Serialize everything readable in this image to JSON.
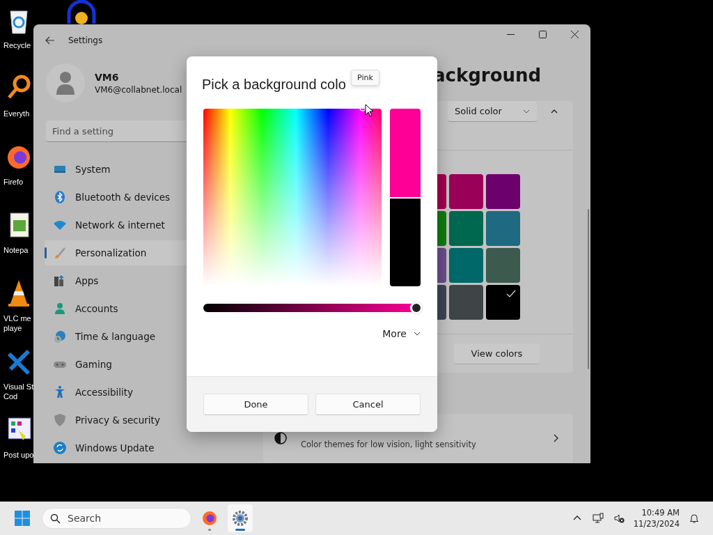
{
  "desktop_icons": [
    {
      "kind": "recycle",
      "label_lines": [
        "Recycle"
      ]
    },
    {
      "kind": "search-tool",
      "label_lines": [
        "Everyth"
      ]
    },
    {
      "kind": "browser",
      "label_lines": [
        "Firefo"
      ]
    },
    {
      "kind": "notepad",
      "label_lines": [
        "Notepa"
      ]
    },
    {
      "kind": "cone",
      "label_lines": [
        "VLC me",
        "playe"
      ]
    },
    {
      "kind": "code",
      "label_lines": [
        "Visual St",
        "Cod"
      ]
    },
    {
      "kind": "grid-app",
      "label_lines": [
        "Post upo"
      ]
    }
  ],
  "settings_window": {
    "title": "Settings",
    "user": {
      "name": "VM6",
      "email": "VM6@collabnet.local"
    },
    "search": {
      "placeholder": "Find a setting"
    },
    "nav": [
      {
        "label": "System",
        "kind": "system",
        "selected": false
      },
      {
        "label": "Bluetooth & devices",
        "kind": "bluetooth",
        "selected": false
      },
      {
        "label": "Network & internet",
        "kind": "network",
        "selected": false
      },
      {
        "label": "Personalization",
        "kind": "brush",
        "selected": true
      },
      {
        "label": "Apps",
        "kind": "apps",
        "selected": false
      },
      {
        "label": "Accounts",
        "kind": "accounts",
        "selected": false
      },
      {
        "label": "Time & language",
        "kind": "time",
        "selected": false
      },
      {
        "label": "Gaming",
        "kind": "gaming",
        "selected": false
      },
      {
        "label": "Accessibility",
        "kind": "accessibility",
        "selected": false
      },
      {
        "label": "Privacy & security",
        "kind": "shield",
        "selected": false
      },
      {
        "label": "Windows Update",
        "kind": "update",
        "selected": false
      }
    ],
    "page_title": "ackground",
    "background_type": "Solid color",
    "swatches": [
      {
        "color": "#a3004d",
        "selected": false
      },
      {
        "color": "#9b0058",
        "selected": false
      },
      {
        "color": "#6c006c",
        "selected": false
      },
      {
        "color": "#107c10",
        "selected": false
      },
      {
        "color": "#00684f",
        "selected": false
      },
      {
        "color": "#1f6981",
        "selected": false
      },
      {
        "color": "#6b4d8c",
        "selected": false
      },
      {
        "color": "#006869",
        "selected": false
      },
      {
        "color": "#3d5a4f",
        "selected": false
      },
      {
        "color": "#3e4453",
        "selected": false
      },
      {
        "color": "#3f4446",
        "selected": false
      },
      {
        "color": "#000000",
        "selected": true
      }
    ],
    "view_colors": "View colors",
    "contrast_description": "Color themes for low vision, light sensitivity"
  },
  "dialog": {
    "title": "Pick a background colo",
    "tooltip": "Pink",
    "previews": [
      {
        "color": "#ff0096"
      },
      {
        "color": "#000000"
      }
    ],
    "brightness": {
      "level": 0.98
    },
    "more": "More",
    "buttons": [
      "Done",
      "Cancel"
    ]
  },
  "taskbar": {
    "search_placeholder": "Search",
    "apps": [
      {
        "kind": "browser",
        "selected": false
      },
      {
        "kind": "settings",
        "selected": true
      }
    ],
    "time": "10:49 AM",
    "date": "11/23/2024"
  }
}
